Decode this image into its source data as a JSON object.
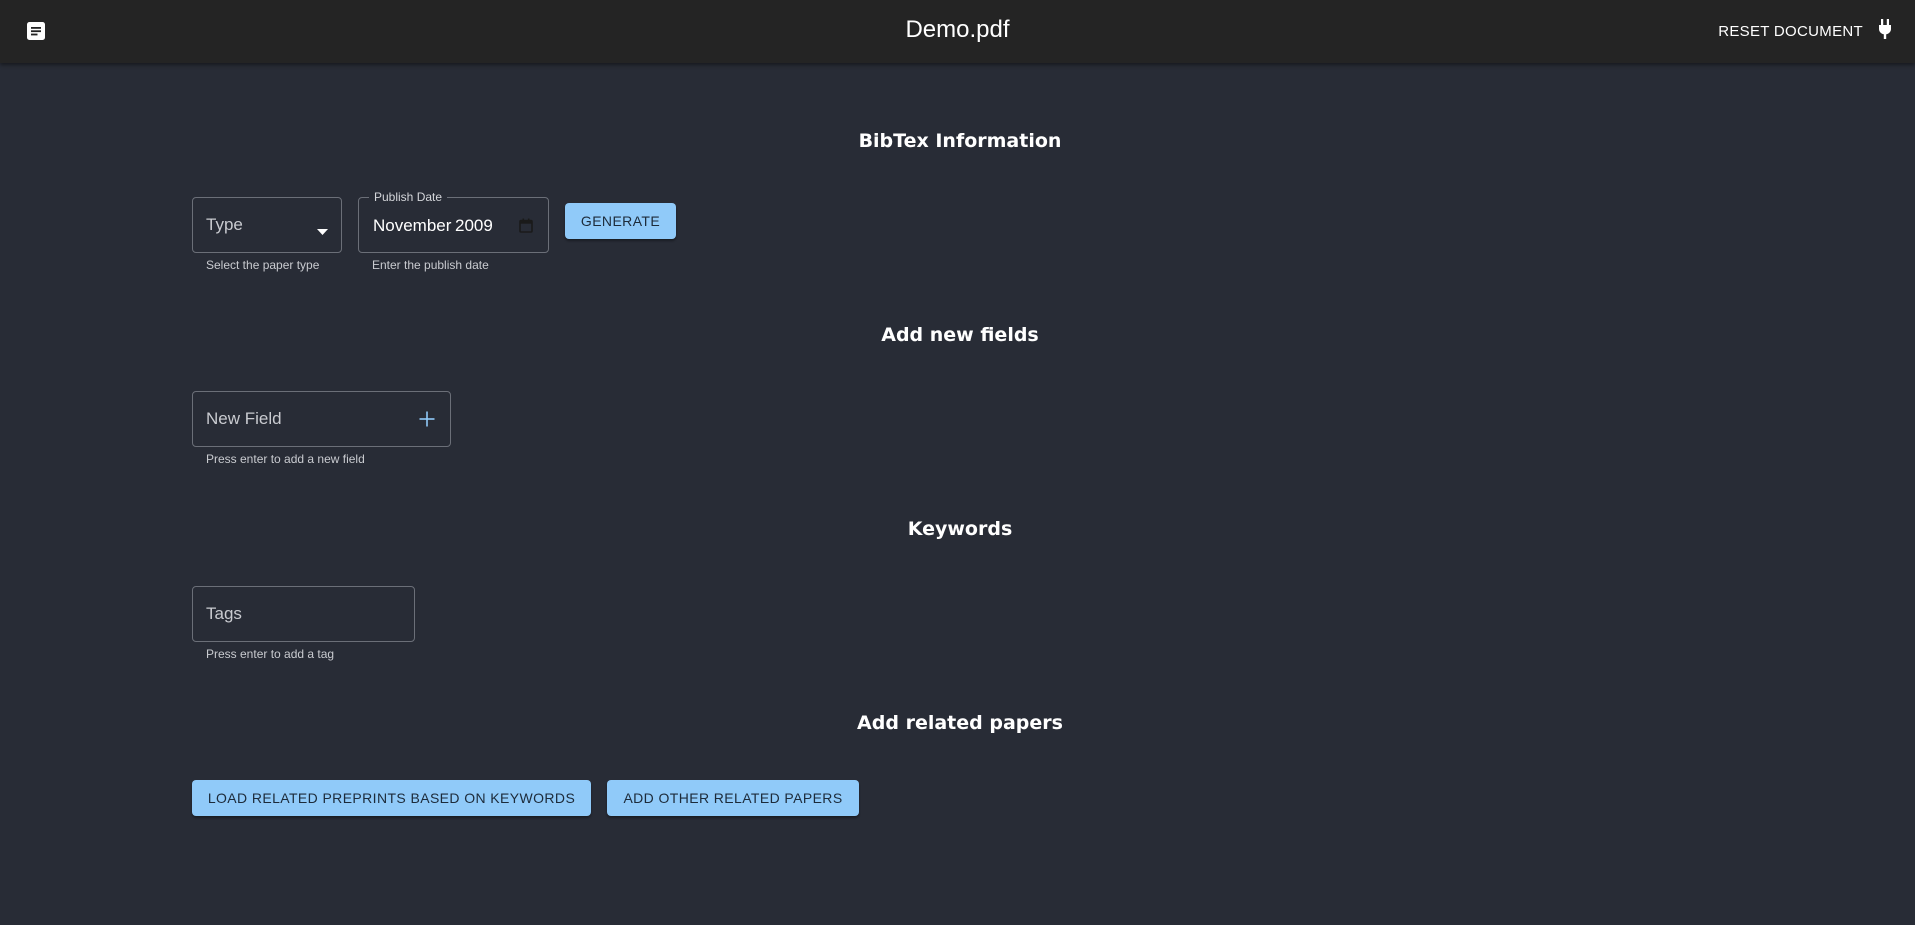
{
  "header": {
    "title": "Demo.pdf",
    "menu_icon": "description-icon",
    "reset_label": "RESET DOCUMENT",
    "reset_icon": "plug-icon"
  },
  "bibtex": {
    "heading": "BibTex Information",
    "type_placeholder": "Type",
    "type_helper": "Select the paper type",
    "date_legend": "Publish Date",
    "date_month": "November",
    "date_year": "2009",
    "date_helper": "Enter the publish date",
    "generate_label": "GENERATE"
  },
  "new_fields": {
    "heading": "Add new fields",
    "placeholder": "New Field",
    "helper": "Press enter to add a new field"
  },
  "keywords": {
    "heading": "Keywords",
    "placeholder": "Tags",
    "helper": "Press enter to add a tag"
  },
  "related": {
    "heading": "Add related papers",
    "load_label": "LOAD RELATED PREPRINTS BASED ON KEYWORDS",
    "add_label": "ADD OTHER RELATED PAPERS"
  },
  "colors": {
    "background": "#282c36",
    "appbar": "#242424",
    "accent": "#90caf9"
  }
}
